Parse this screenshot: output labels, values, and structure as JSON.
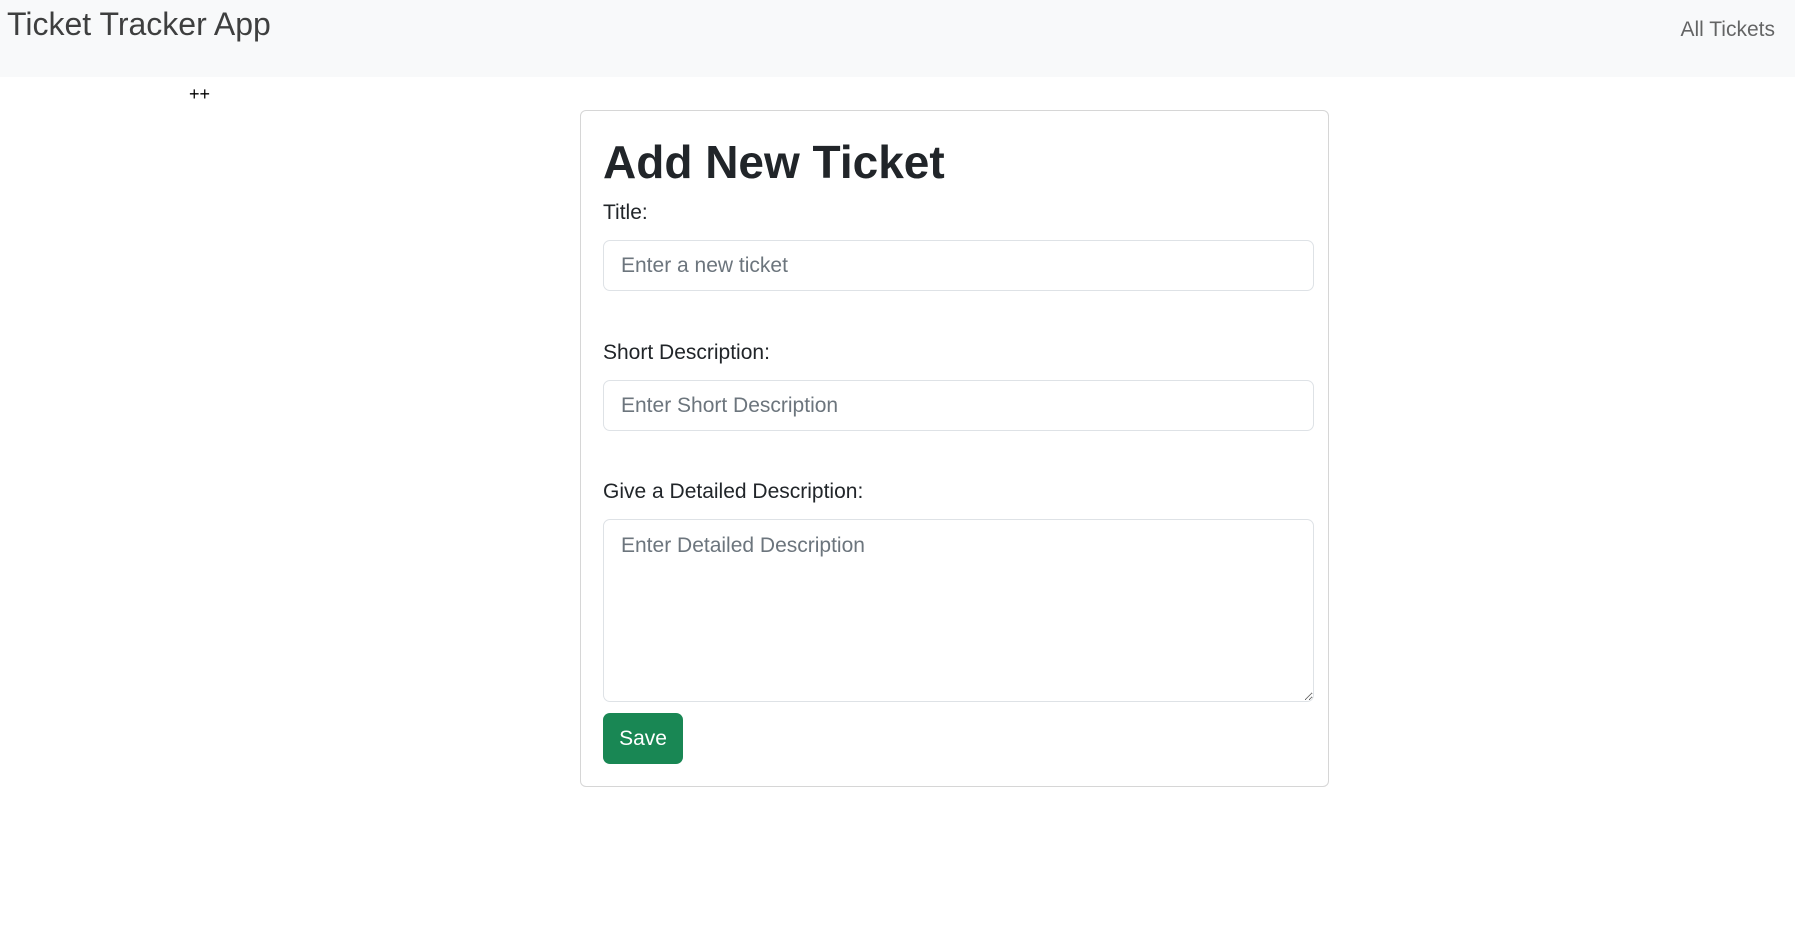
{
  "navbar": {
    "brand": "Ticket Tracker App",
    "links": [
      {
        "label": "All Tickets"
      }
    ]
  },
  "stray_text": "++",
  "form": {
    "heading": "Add New Ticket",
    "title_label": "Title:",
    "title_placeholder": "Enter a new ticket",
    "short_label": "Short Description:",
    "short_placeholder": "Enter Short Description",
    "detail_label": "Give a Detailed Description:",
    "detail_placeholder": "Enter Detailed Description",
    "save_label": "Save"
  },
  "colors": {
    "save": "#198754",
    "navbar_bg": "#f8f9fa"
  }
}
